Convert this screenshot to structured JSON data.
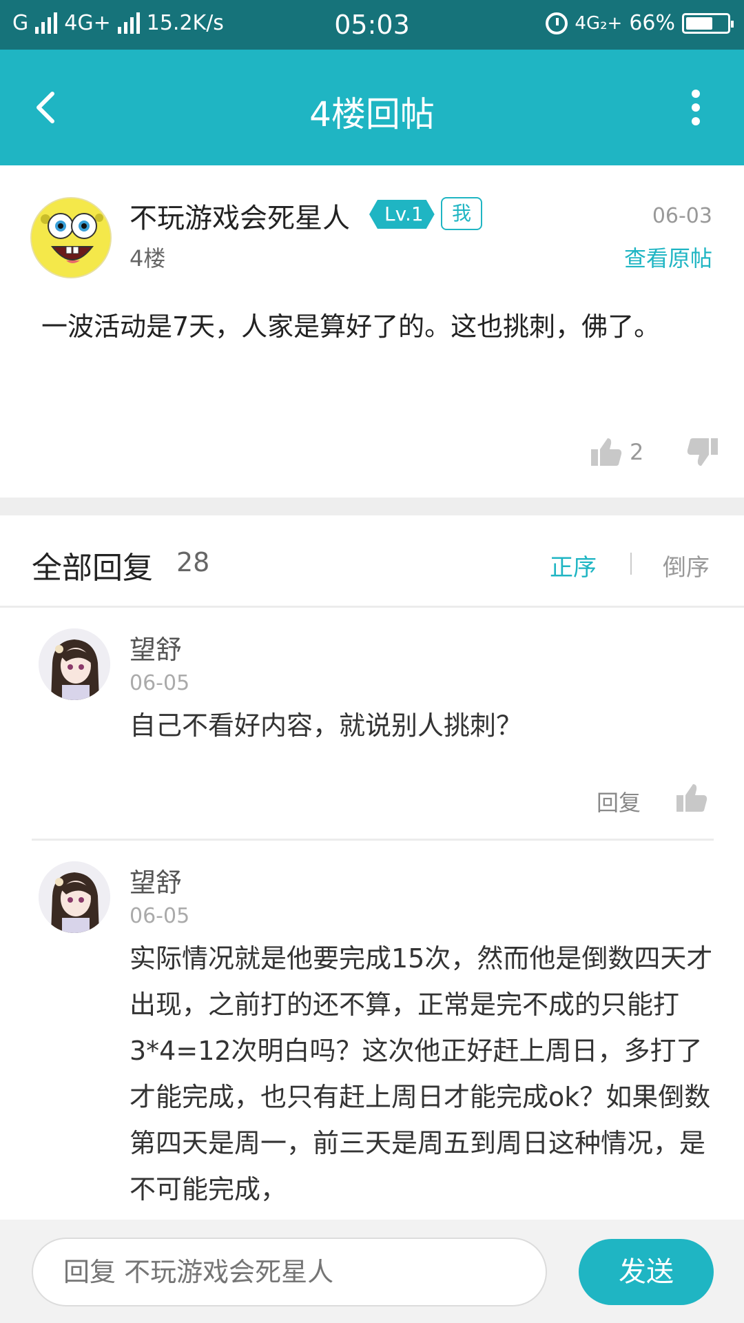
{
  "status_bar": {
    "carrier1": "G",
    "network": "4G+",
    "speed": "15.2K/s",
    "time": "05:03",
    "network2": "4G₂+",
    "battery": "66%",
    "battery_level": 0.66
  },
  "app_bar": {
    "title": "4楼回帖",
    "back_icon": "chevron-left-icon",
    "more_icon": "more-vertical-icon"
  },
  "post": {
    "author": "不玩游戏会死星人",
    "level": "Lv.1",
    "me_badge": "我",
    "date": "06-03",
    "floor": "4楼",
    "view_original": "查看原帖",
    "body": "一波活动是7天，人家是算好了的。这也挑刺，佛了。",
    "likes": "2"
  },
  "replies_header": {
    "title": "全部回复",
    "count": "28",
    "sort_asc": "正序",
    "sort_desc": "倒序"
  },
  "replies": [
    {
      "name": "望舒",
      "date": "06-05",
      "text": "自己不看好内容，就说别人挑刺？",
      "reply_label": "回复"
    },
    {
      "name": "望舒",
      "date": "06-05",
      "text": "实际情况就是他要完成15次，然而他是倒数四天才出现，之前打的还不算，正常是完不成的只能打3*4=12次明白吗？这次他正好赶上周日，多打了才能完成，也只有赶上周日才能完成ok？如果倒数第四天是周一，前三天是周五到周日这种情况，是不可能完成，"
    }
  ],
  "bottom_bar": {
    "placeholder": "回复 不玩游戏会死星人",
    "send_label": "发送"
  },
  "colors": {
    "status_bar": "#16737a",
    "accent": "#1fb5c3"
  }
}
